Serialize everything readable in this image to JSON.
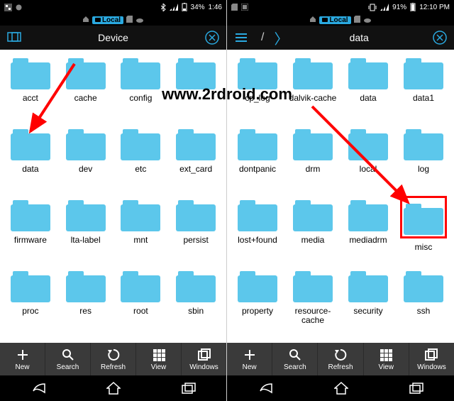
{
  "watermark": "www.2rdroid.com",
  "left": {
    "status": {
      "battery": "34%",
      "time": "1:46"
    },
    "path_chip": "Local",
    "header_title": "Device",
    "folders": [
      "acct",
      "cache",
      "config",
      "",
      "data",
      "dev",
      "etc",
      "ext_card",
      "firmware",
      "lta-label",
      "mnt",
      "persist",
      "proc",
      "res",
      "root",
      "sbin"
    ],
    "tools": [
      {
        "label": "New",
        "icon": "plus"
      },
      {
        "label": "Search",
        "icon": "search"
      },
      {
        "label": "Refresh",
        "icon": "refresh"
      },
      {
        "label": "View",
        "icon": "grid"
      },
      {
        "label": "Windows",
        "icon": "windows"
      }
    ]
  },
  "right": {
    "status": {
      "battery": "91%",
      "time": "12:10 PM"
    },
    "path_chip": "Local",
    "header_path": {
      "sep": "/",
      "current": "data"
    },
    "folders": [
      "cp_log",
      "dalvik-cache",
      "data",
      "data1",
      "dontpanic",
      "drm",
      "local",
      "log",
      "lost+found",
      "media",
      "mediadrm",
      "misc",
      "property",
      "resource-cache",
      "security",
      "ssh"
    ],
    "highlighted": "misc",
    "tools": [
      {
        "label": "New",
        "icon": "plus"
      },
      {
        "label": "Search",
        "icon": "search"
      },
      {
        "label": "Refresh",
        "icon": "refresh"
      },
      {
        "label": "View",
        "icon": "grid"
      },
      {
        "label": "Windows",
        "icon": "windows"
      }
    ]
  }
}
